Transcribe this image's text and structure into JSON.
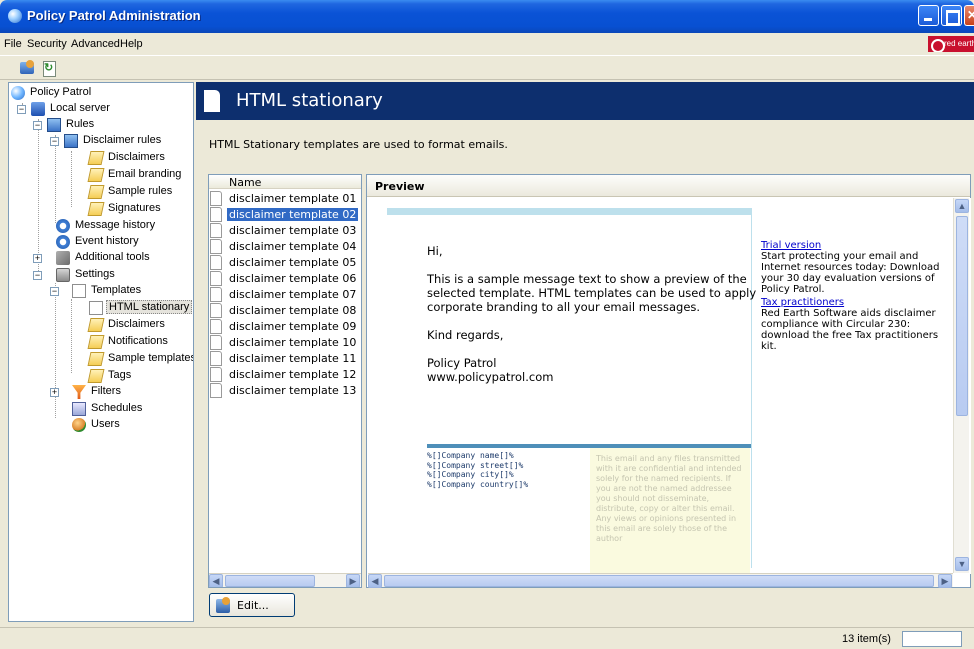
{
  "window": {
    "title": "Policy Patrol Administration"
  },
  "menu": {
    "items": [
      "File",
      "Security",
      "Advanced",
      "Help"
    ],
    "brand": "red earth"
  },
  "toolbar": {
    "icons": [
      "properties-icon",
      "refresh-icon"
    ]
  },
  "tree": {
    "root": "Policy Patrol",
    "local_server": "Local server",
    "rules": "Rules",
    "disclaimer_rules": "Disclaimer rules",
    "disclaimers": "Disclaimers",
    "email_branding": "Email branding",
    "sample_rules": "Sample rules",
    "signatures": "Signatures",
    "message_history": "Message history",
    "event_history": "Event history",
    "additional_tools": "Additional tools",
    "settings": "Settings",
    "templates": "Templates",
    "html_stationary": "HTML stationary",
    "tpl_disclaimers": "Disclaimers",
    "notifications": "Notifications",
    "sample_templates": "Sample templates",
    "tags": "Tags",
    "filters": "Filters",
    "schedules": "Schedules",
    "users": "Users"
  },
  "content": {
    "title": "HTML stationary",
    "description": "HTML Stationary templates are used to format emails.",
    "list_header": "Name",
    "templates": [
      "disclaimer template 01",
      "disclaimer template 02",
      "disclaimer template 03",
      "disclaimer template 04",
      "disclaimer template 05",
      "disclaimer template 06",
      "disclaimer template 07",
      "disclaimer template 08",
      "disclaimer template 09",
      "disclaimer template 10",
      "disclaimer template 11",
      "disclaimer template 12",
      "disclaimer template 13"
    ],
    "selected_index": 1,
    "preview_header": "Preview",
    "edit_button": "Edit..."
  },
  "preview": {
    "greeting": "Hi,",
    "body": "This is a sample message text to show a preview of the selected template. HTML templates can be used to apply corporate branding to all your email messages.",
    "closing": "Kind regards,",
    "sender_name": "Policy Patrol",
    "sender_url": "www.policypatrol.com",
    "address_lines": [
      "%[]Company name[]%",
      "%[]Company street[]%",
      "%[]Company city[]%",
      "%[]Company country[]%"
    ],
    "disclaimer": "This email and any files transmitted with it are confidential and intended solely for the named recipients. If you are not the named addressee you should not disseminate, distribute, copy or alter this email. Any views or opinions presented in this email are solely those of the author",
    "ad1_link": "Trial version",
    "ad1_text": "Start protecting your email and Internet resources today: Download your 30 day evaluation versions of Policy Patrol.",
    "ad2_link": "Tax practitioners",
    "ad2_text": "Red Earth Software aids disclaimer compliance with Circular 230: download the free Tax practitioners kit."
  },
  "status": {
    "count": "13 item(s)"
  },
  "colors": {
    "titlebar": "#0a53d6",
    "banner": "#0d2f6e",
    "selection": "#316ac5",
    "email_top_bar": "#bde0ec",
    "email_bottom_bar": "#4e8fb9"
  }
}
